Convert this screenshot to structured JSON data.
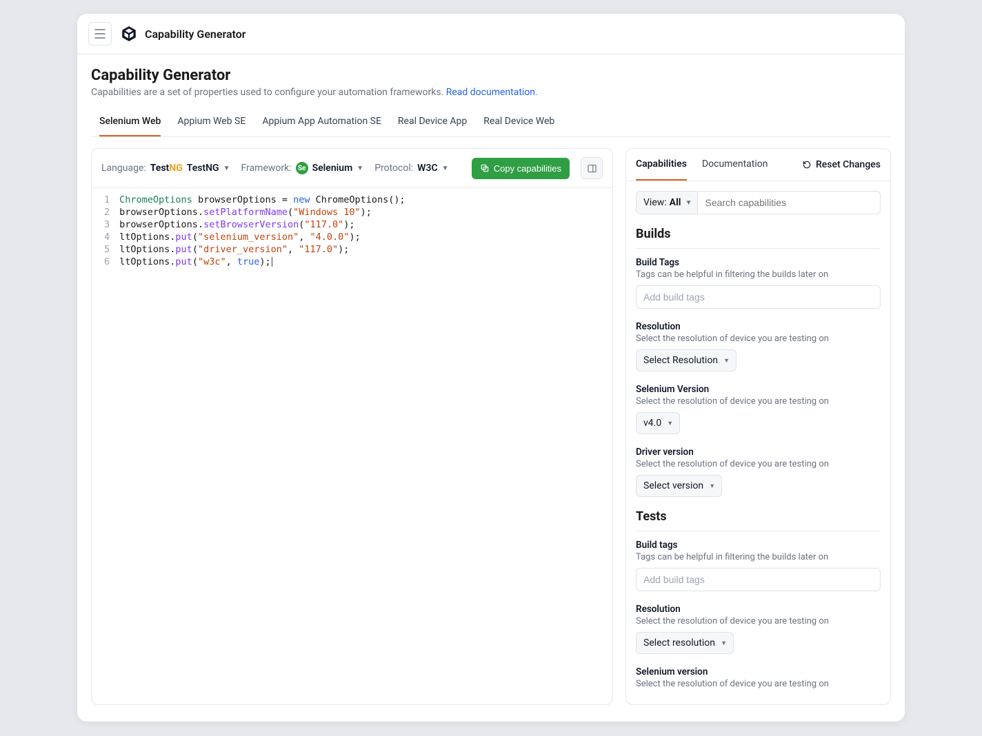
{
  "app_title": "Capability Generator",
  "page_title": "Capability Generator",
  "page_desc_prefix": "Capabilities are a set of properties used to configure your automation frameworks. ",
  "doc_link_text": "Read documentation",
  "main_tabs": [
    "Selenium Web",
    "Appium Web SE",
    "Appium App Automation SE",
    "Real Device App",
    "Real Device Web"
  ],
  "toolbar": {
    "language_label": "Language:",
    "language_value_prefix": "Test",
    "language_value_suffix": "NG",
    "language_value_after": " TestNG",
    "framework_label": "Framework:",
    "framework_value": "Selenium",
    "protocol_label": "Protocol:",
    "protocol_value": "W3C",
    "copy_button": "Copy capabilities"
  },
  "code_lines": [
    {
      "n": "1"
    },
    {
      "n": "2"
    },
    {
      "n": "3"
    },
    {
      "n": "4"
    },
    {
      "n": "5"
    },
    {
      "n": "6"
    }
  ],
  "code": {
    "l1_type1": "ChromeOptions",
    "l1_rest1": " browserOptions = ",
    "l1_kw": "new",
    "l1_rest2": " ChromeOptions();",
    "l2_pre": "browserOptions.",
    "l2_m": "setPlatformName",
    "l2_open": "(",
    "l2_s": "\"Windows 10\"",
    "l2_close": ");",
    "l3_pre": "browserOptions.",
    "l3_m": "setBrowserVersion",
    "l3_open": "(",
    "l3_s": "\"117.0\"",
    "l3_close": ");",
    "l4_pre": "ltOptions.",
    "l4_m": "put",
    "l4_open": "(",
    "l4_s1": "\"selenium_version\"",
    "l4_mid": ", ",
    "l4_s2": "\"4.0.0\"",
    "l4_close": ");",
    "l5_pre": "ltOptions.",
    "l5_m": "put",
    "l5_open": "(",
    "l5_s1": "\"driver_version\"",
    "l5_mid": ", ",
    "l5_s2": "\"117.0\"",
    "l5_close": ");",
    "l6_pre": "ltOptions.",
    "l6_m": "put",
    "l6_open": "(",
    "l6_s1": "\"w3c\"",
    "l6_mid": ", ",
    "l6_b": "true",
    "l6_close": ");"
  },
  "side": {
    "tabs": [
      "Capabilities",
      "Documentation"
    ],
    "reset": "Reset Changes",
    "view_label": "View: ",
    "view_value": "All",
    "search_placeholder": "Search capabilities",
    "section_builds": "Builds",
    "section_tests": "Tests",
    "builds": {
      "build_tags": {
        "label": "Build Tags",
        "desc": "Tags can be helpful in filtering the builds later on",
        "placeholder": "Add build tags"
      },
      "resolution": {
        "label": "Resolution",
        "desc": "Select the resolution of device you are testing on",
        "select": "Select Resolution"
      },
      "selenium": {
        "label": "Selenium Version",
        "desc": "Select the resolution of device you are testing on",
        "select": "v4.0"
      },
      "driver": {
        "label": "Driver version",
        "desc": "Select the resolution of device you are testing on",
        "select": "Select version"
      }
    },
    "tests": {
      "build_tags": {
        "label": "Build tags",
        "desc": "Tags can be helpful in filtering the builds later on",
        "placeholder": "Add build tags"
      },
      "resolution": {
        "label": "Resolution",
        "desc": "Select the resolution of device you are testing on",
        "select": "Select resolution"
      },
      "selenium": {
        "label": "Selenium version",
        "desc": "Select the resolution of device you are testing on"
      }
    }
  }
}
